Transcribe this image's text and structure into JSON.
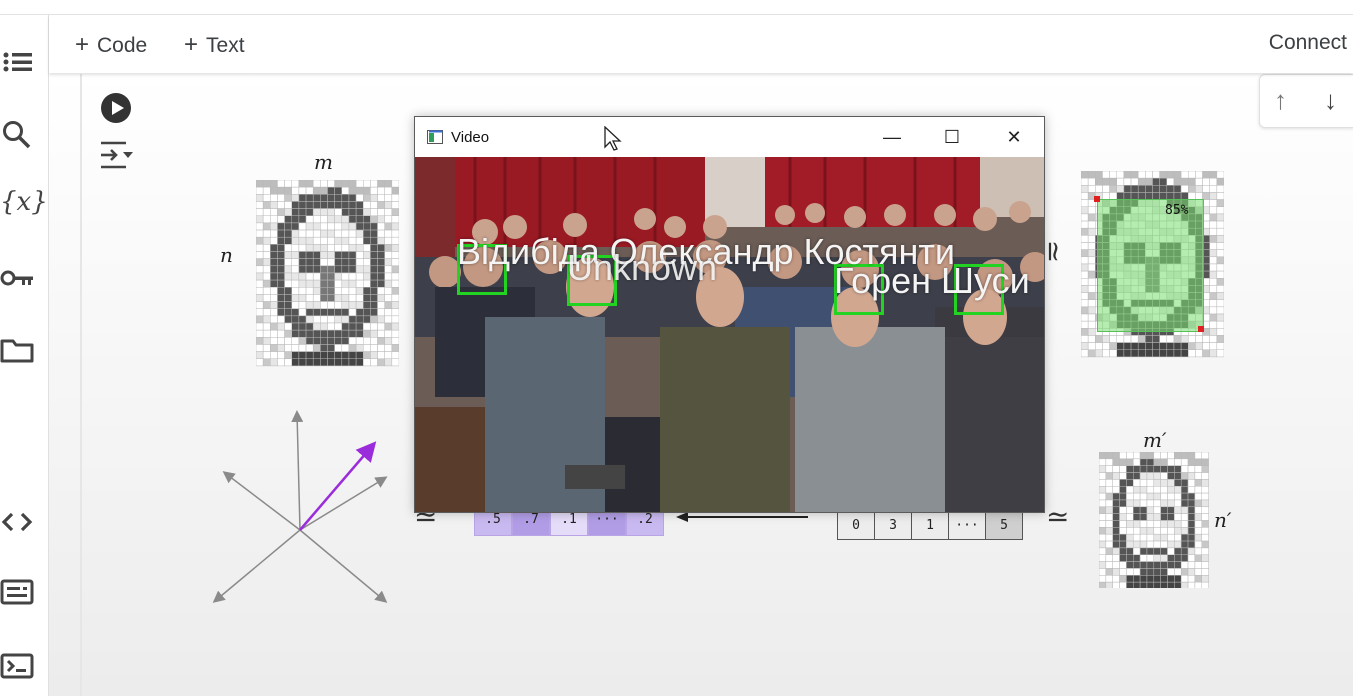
{
  "toolbar": {
    "code_label": "Code",
    "text_label": "Text",
    "plus": "+",
    "connect_label": "Connect"
  },
  "sidebar": {
    "icons": [
      "table-of-contents-icon",
      "search-icon",
      "variables-icon",
      "key-icon",
      "folder-icon",
      "code-snippets-icon",
      "command-palette-icon",
      "terminal-icon"
    ],
    "variables_glyph": "{x}"
  },
  "cell_tools": {
    "up": "↑",
    "down": "↓"
  },
  "video_window": {
    "title": "Video",
    "minimize": "—",
    "maximize": "☐",
    "close": "✕",
    "labels": [
      "Відибіда Олександр Костянти",
      "Unknown",
      "Горен Шуси"
    ]
  },
  "figure": {
    "m_label": "m",
    "n_label": "n",
    "m_prime_label": "m′",
    "n_prime_label": "n′",
    "approx": "≃",
    "vector_values": [
      ".5",
      ".7",
      ".1",
      "···",
      ".2"
    ],
    "index_values": [
      "0",
      "3",
      "1",
      "···",
      "5"
    ],
    "confidence": "85%",
    "colors": {
      "face_box": "#22d322",
      "vector_purple": "#b9a5e6",
      "arrow_purple": "#9b2cdb",
      "grid_dark": "#5a5a5a"
    }
  }
}
